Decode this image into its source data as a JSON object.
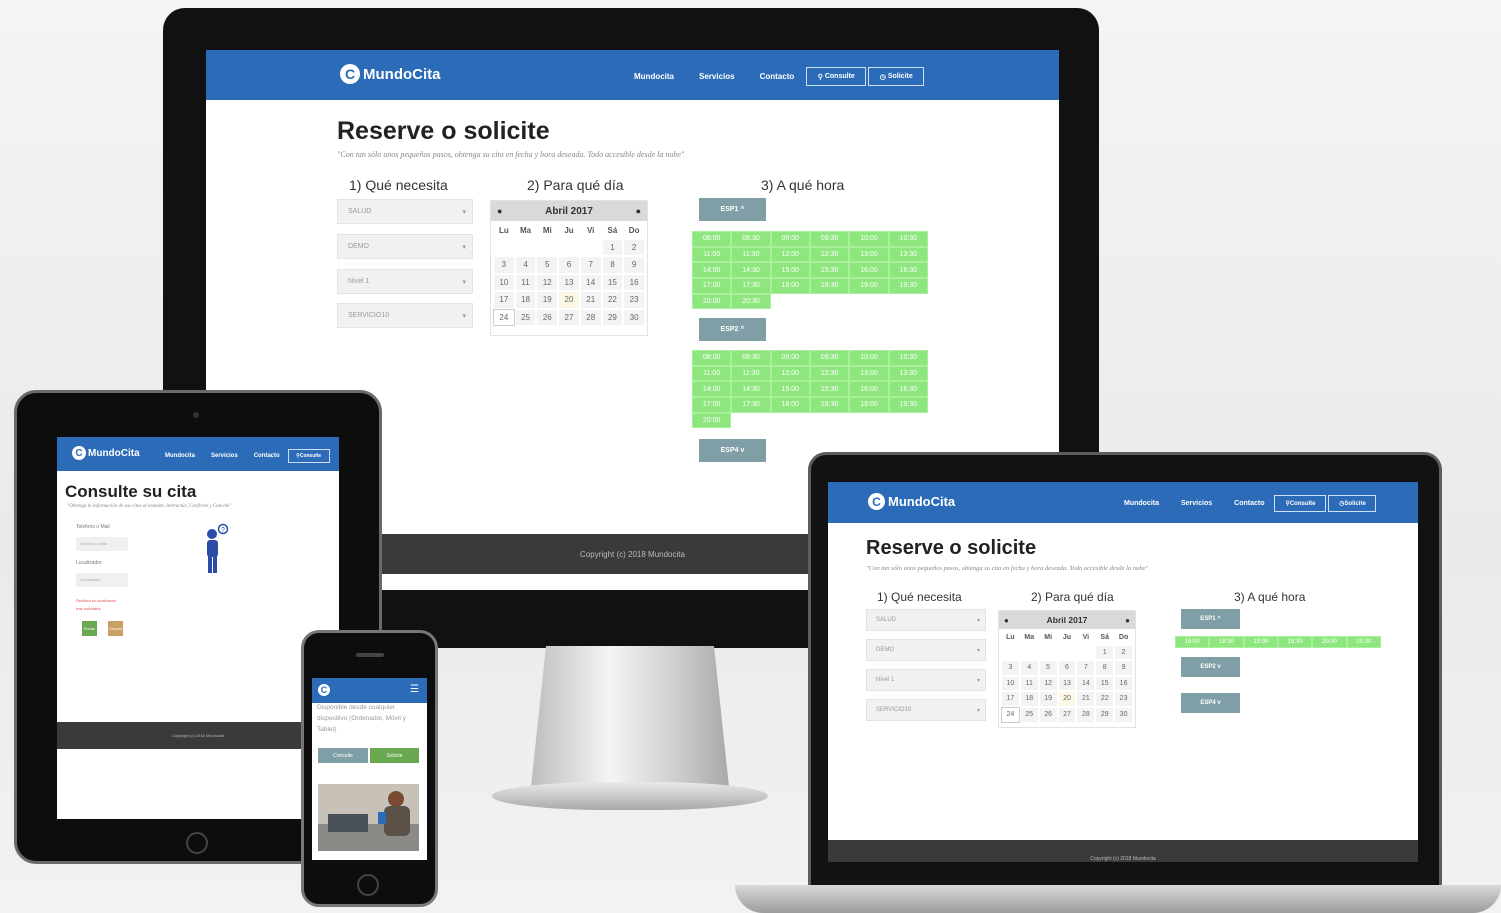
{
  "brand": "MundoCita",
  "nav": {
    "links": [
      "Mundocita",
      "Servicios",
      "Contacto"
    ],
    "consulte": "Consulte",
    "solicite": "Solicite"
  },
  "booking": {
    "title": "Reserve o solicite",
    "quote": "\"Con tan sólo unos pequeños pasos, obtenga su cita en fecha y hora deseada. Todo accesible desde la nube\"",
    "col1": "1) Qué necesita",
    "col2": "2) Para qué día",
    "col3": "3) A qué hora",
    "selects": [
      "SALUD",
      "DEMO",
      "Nivel 1",
      "SERVICIO10"
    ],
    "calendar": {
      "month": "Abril 2017",
      "dow": [
        "Lu",
        "Ma",
        "Mi",
        "Ju",
        "Vi",
        "Sá",
        "Do"
      ],
      "leading_blanks": 5,
      "days": [
        "1",
        "2",
        "3",
        "4",
        "5",
        "6",
        "7",
        "8",
        "9",
        "10",
        "11",
        "12",
        "13",
        "14",
        "15",
        "16",
        "17",
        "18",
        "19",
        "20",
        "21",
        "22",
        "23",
        "24",
        "25",
        "26",
        "27",
        "28",
        "29",
        "30"
      ],
      "today": "20",
      "selected": "24"
    },
    "esp1": "ESP1 ^",
    "esp2": "ESP2 ^",
    "esp4": "ESP4 v",
    "esp1_slots": [
      "08:00",
      "08:30",
      "09:00",
      "09:30",
      "10:00",
      "10:30",
      "11:00",
      "11:30",
      "12:00",
      "12:30",
      "13:00",
      "13:30",
      "14:00",
      "14:30",
      "15:00",
      "15:30",
      "16:00",
      "16:30",
      "17:00",
      "17:30",
      "18:00",
      "18:30",
      "19:00",
      "19:30",
      "20:00",
      "20:30"
    ],
    "esp2_slots": [
      "08:00",
      "08:30",
      "09:00",
      "09:30",
      "10:00",
      "10:30",
      "11:00",
      "11:30",
      "12:00",
      "12:30",
      "13:00",
      "13:30",
      "14:00",
      "14:30",
      "15:00",
      "15:30",
      "16:00",
      "16:30",
      "17:00",
      "17:30",
      "18:00",
      "18:30",
      "19:00",
      "19:30",
      "20:00"
    ],
    "laptop_esp1_slots": [
      "18:00",
      "18:30",
      "19:00",
      "19:30",
      "20:00",
      "20:30"
    ],
    "laptop_esp2": "ESP2 v",
    "laptop_esp4": "ESP4 v"
  },
  "footer": "Copyright (c) 2018 Mundocita",
  "tablet": {
    "title": "Consulte su cita",
    "quote": "\"Obtenga la información de sus citas al instante. Interactúe, Confirme y Cancele\"",
    "label_phone": "Telefono o Mail",
    "placeholder_phone": "Telefono o Mail",
    "label_loc": "Localizador",
    "placeholder_loc": "Localizador",
    "red_note1": "Recibirá su localizador",
    "red_note2": "tras solicitarla",
    "btn1": "Enviar",
    "btn2": "Limpiar",
    "footer": "Copyright (c) 2018 Mundocita"
  },
  "phone": {
    "text": "Disponible desde cualquier dispositivo (Ordenador, Móvil y Tablet)",
    "btn1": "Consulte",
    "btn2": "Solicite"
  },
  "colors": {
    "brand": "#2b6bb8",
    "slot": "#8ee77e",
    "esp": "#7f9ea6"
  }
}
